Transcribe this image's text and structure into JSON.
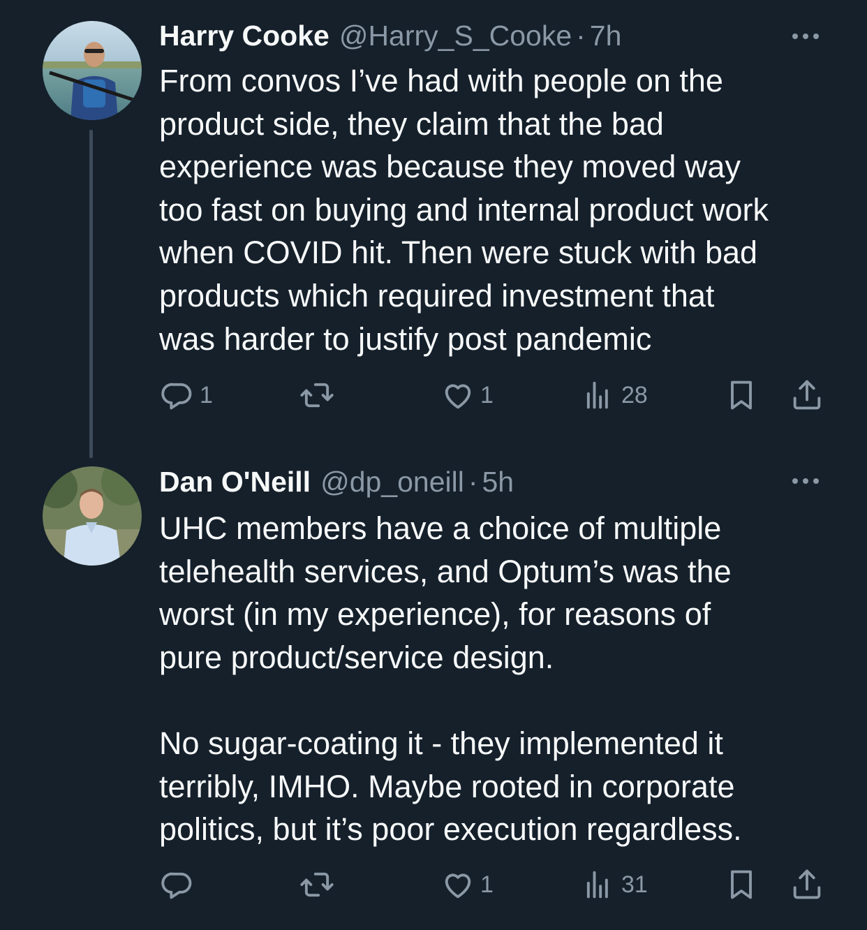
{
  "tweets": [
    {
      "display_name": "Harry Cooke",
      "handle": "@Harry_S_Cooke",
      "separator": "·",
      "time": "7h",
      "text": "From convos I’ve had with people on the\nproduct side, they claim that the bad\nexperience was because they moved way\ntoo fast on buying and internal product work\nwhen COVID hit. Then were stuck with bad\nproducts which required investment that\nwas harder to justify post pandemic",
      "replies": "1",
      "retweets": "",
      "likes": "1",
      "views": "28"
    },
    {
      "display_name": "Dan O'Neill",
      "handle": "@dp_oneill",
      "separator": "·",
      "time": "5h",
      "text": "UHC members have a choice of multiple\ntelehealth services, and Optum’s was the\nworst (in my experience), for reasons of\npure product/service design.\n\nNo sugar-coating it - they implemented it\nterribly, IMHO.  Maybe rooted in corporate\npolitics, but it’s poor execution regardless.",
      "replies": "",
      "retweets": "",
      "likes": "1",
      "views": "31"
    }
  ],
  "icons": {
    "reply": "reply-icon",
    "retweet": "retweet-icon",
    "like": "heart-icon",
    "views": "views-chart-icon",
    "bookmark": "bookmark-icon",
    "share": "share-icon",
    "more": "more-dots-icon"
  },
  "colors": {
    "background": "#15202b",
    "text": "#f7f9f9",
    "secondary": "#8b98a5",
    "thread_line": "#3d4b59"
  }
}
